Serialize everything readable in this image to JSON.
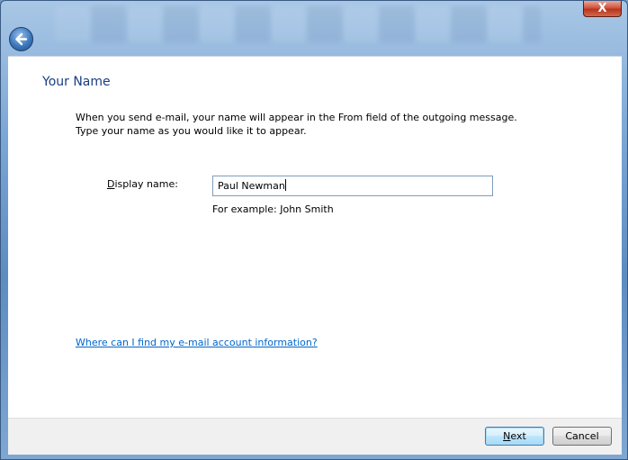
{
  "window": {
    "close_glyph": "X"
  },
  "page": {
    "title": "Your Name",
    "description_line1": "When you send e-mail, your name will appear in the From field of the outgoing message.",
    "description_line2": "Type your name as you would like it to appear."
  },
  "form": {
    "display_name_label_first": "D",
    "display_name_label_rest": "isplay name:",
    "display_name_value": "Paul Newman",
    "example_text": "For example: John Smith"
  },
  "help": {
    "link_text": "Where can I find my e-mail account information?"
  },
  "buttons": {
    "next_first": "N",
    "next_rest": "ext",
    "cancel_label": "Cancel"
  },
  "icons": {
    "back": "back-arrow-icon",
    "close": "close-icon"
  }
}
